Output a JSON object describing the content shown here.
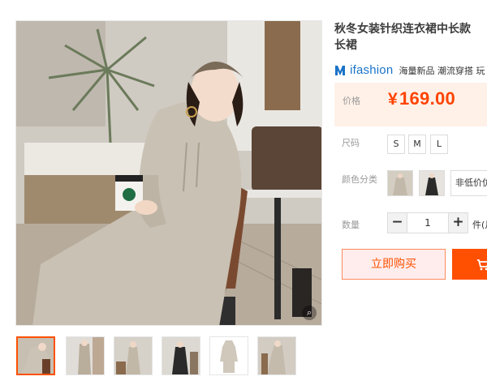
{
  "product": {
    "title_line1": "秋冬女装针织连衣裙中长款",
    "title_line2": "长裙"
  },
  "brand": {
    "name": "ifashion",
    "tags": "海量新品 潮流穿搭 玩"
  },
  "price": {
    "label": "价格",
    "currency": "¥",
    "value": "169.00"
  },
  "size": {
    "label": "尺码",
    "options": [
      "S",
      "M",
      "L"
    ]
  },
  "color": {
    "label": "颜色分类",
    "visible_option_text": "非低价仿"
  },
  "quantity": {
    "label": "数量",
    "minus": "−",
    "value": "1",
    "plus": "+",
    "unit": "件(月"
  },
  "actions": {
    "buy_now": "立即购买",
    "cart_icon": "cart-icon"
  },
  "colors": {
    "accent": "#ff5000",
    "price": "#ff4400",
    "price_panel_bg": "#fff1e8",
    "brand_blue": "#1a73c8"
  }
}
